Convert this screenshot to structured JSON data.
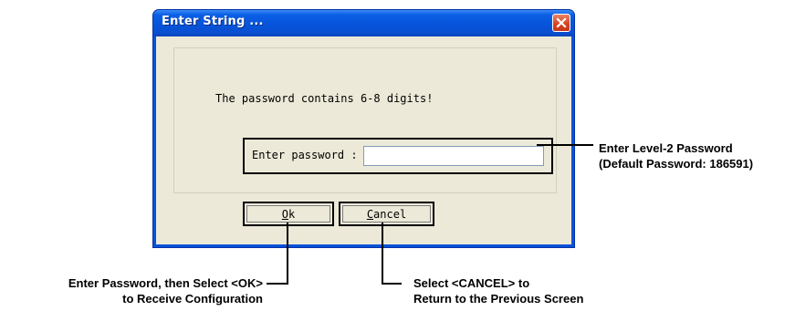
{
  "window": {
    "title": "Enter String ...",
    "message": "The password contains 6-8 digits!",
    "password_label": "Enter password :",
    "password_value": "",
    "ok_label_underlined": "O",
    "ok_label_rest": "k",
    "cancel_label_underlined": "C",
    "cancel_label_rest": "ancel"
  },
  "callouts": {
    "password": {
      "line1": "Enter Level-2 Password",
      "line2": "(Default Password: 186591)"
    },
    "ok": {
      "line1": "Enter Password, then Select <OK>",
      "line2": "to Receive Configuration"
    },
    "cancel": {
      "line1": "Select <CANCEL> to",
      "line2": "Return to the Previous Screen"
    }
  },
  "colors": {
    "title_bar": "#0654d9",
    "dialog_face": "#ece9d8",
    "close_button": "#d8401d"
  }
}
